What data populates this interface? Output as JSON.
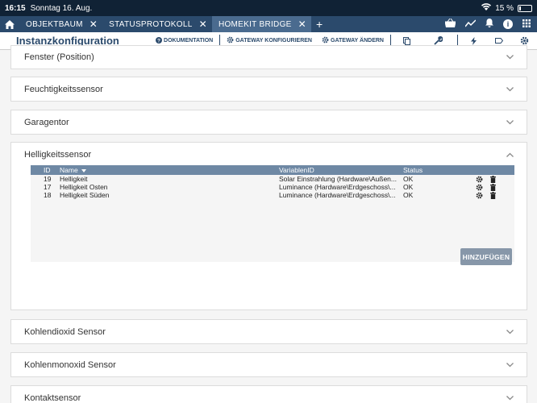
{
  "status_bar": {
    "time": "16:15",
    "date": "Sonntag 16. Aug.",
    "battery": "15 %"
  },
  "tabs": [
    {
      "label": "OBJEKTBAUM"
    },
    {
      "label": "STATUSPROTOKOLL"
    },
    {
      "label": "HOMEKIT BRIDGE"
    }
  ],
  "toolbar": {
    "title": "Instanzkonfiguration",
    "documentation": "DOKUMENTATION",
    "configure_gateway": "GATEWAY KONFIGURIEREN",
    "change_gateway": "GATEWAY ÄNDERN"
  },
  "panels": {
    "fenster": "Fenster (Position)",
    "feuchtigkeit": "Feuchtigkeitssensor",
    "garagentor": "Garagentor",
    "helligkeit": "Helligkeitssensor",
    "kohlendioxid": "Kohlendioxid Sensor",
    "kohlenmonoxid": "Kohlenmonoxid Sensor",
    "kontakt": "Kontaktsensor"
  },
  "table": {
    "headers": {
      "id": "ID",
      "name": "Name",
      "variable": "VariablenID",
      "status": "Status"
    },
    "rows": [
      {
        "id": "19",
        "name": "Helligkeit",
        "variable": "Solar Einstrahlung (Hardware\\Außen...",
        "status": "OK"
      },
      {
        "id": "17",
        "name": "Helligkeit Osten",
        "variable": "Luminance (Hardware\\Erdgeschoss\\...",
        "status": "OK"
      },
      {
        "id": "18",
        "name": "Helligkeit Süden",
        "variable": "Luminance (Hardware\\Erdgeschoss\\...",
        "status": "OK"
      }
    ]
  },
  "add_button": "HINZUFÜGEN"
}
